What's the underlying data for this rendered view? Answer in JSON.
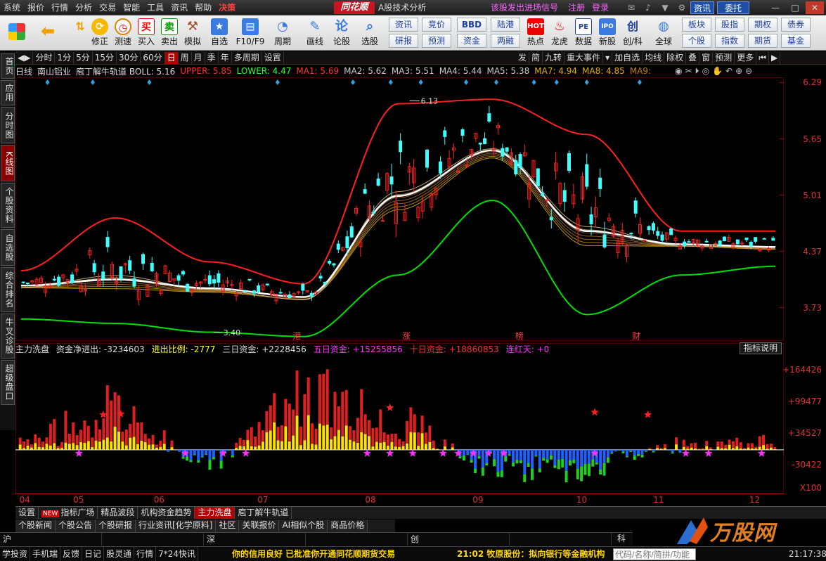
{
  "menubar": {
    "items": [
      "系统",
      "报价",
      "行情",
      "分析",
      "交易",
      "智能",
      "工具",
      "资讯",
      "帮助",
      "决策"
    ],
    "logo": "同花顺",
    "subtitle": "A股技术分析",
    "signal": "该股发出进场信号",
    "register": "注册",
    "login": "登录",
    "info_button": "资讯",
    "trust_button": "委托"
  },
  "toolbar": {
    "buttons": [
      "修正",
      "测速",
      "买入",
      "卖出",
      "模拟",
      "自选",
      "F10/F9",
      "周期",
      "画线",
      "论股",
      "选股"
    ],
    "quick_links": [
      "资讯",
      "竞价",
      "BBD",
      "陆港",
      "研报",
      "预测",
      "资金",
      "两融"
    ],
    "feature_buttons": [
      "热点",
      "龙虎",
      "数据",
      "新股",
      "创/科",
      "全球"
    ],
    "right_links": [
      "板块",
      "股指",
      "期权",
      "债券",
      "个股",
      "指数",
      "期货",
      "基金"
    ]
  },
  "side_tabs": [
    "首页",
    "应用",
    "分时图",
    "K线图",
    "个股资料",
    "自选股",
    "综合排名",
    "牛叉诊股",
    "超级盘口"
  ],
  "period_bar": {
    "items": [
      "分时",
      "1分",
      "5分",
      "15分",
      "30分",
      "60分",
      "日",
      "周",
      "月",
      "季",
      "年",
      "多周期",
      "设置"
    ],
    "active": "日",
    "right_items": [
      "发",
      "简",
      "九转",
      "重大事件",
      "加自选",
      "均线",
      "除权",
      "叠",
      "窗",
      "预测",
      "更多"
    ]
  },
  "indicator_line": {
    "period": "日线",
    "stock": "南山铝业",
    "indicator": "庖丁解牛轨道 BOLL: 5.16",
    "upper": "UPPER: 5.85",
    "lower": "LOWER: 4.47",
    "ma1": "MA1: 5.69",
    "ma2": "MA2: 5.62",
    "ma3": "MA3: 5.51",
    "ma4": "MA4: 5.44",
    "ma5": "MA5: 5.38",
    "ma7": "MA7: 4.94",
    "ma8": "MA8: 4.85",
    "ma9": "MA9:"
  },
  "main_axis": [
    "6.29",
    "5.65",
    "5.01",
    "4.37",
    "3.73"
  ],
  "annotations": {
    "high": "6.13",
    "low": "3.40",
    "markers": [
      "港",
      "涨",
      "榜",
      "财"
    ]
  },
  "sub_legend": {
    "name": "主力洗盘",
    "net_flow": "资金净进出: -3234603",
    "ratio": "进出比例: -2777",
    "three_day": "三日资金: +2228456",
    "five_day": "五日资金: +15255856",
    "ten_day": "十日资金: +18860853",
    "streak": "连红天: +0",
    "explain_button": "指标说明"
  },
  "sub_axis": [
    "+164426",
    "+99477",
    "+34527",
    "-30422",
    "X100"
  ],
  "months": [
    "04",
    "05",
    "06",
    "07",
    "08",
    "09",
    "10",
    "11",
    "12"
  ],
  "indicator_tabs": [
    "设置",
    "指标广场",
    "精品波段",
    "机构资金趋势",
    "主力洗盘",
    "庖丁解牛轨道"
  ],
  "new_badge": "NEW",
  "news_tabs": [
    "个股新闻",
    "个股公告",
    "个股研报",
    "行业资讯[化学原料]",
    "社区",
    "关联报价",
    "AI相似个股",
    "商品价格"
  ],
  "index_bar": [
    "沪",
    "深",
    "创",
    "科"
  ],
  "status_links": [
    "学投资",
    "手机端",
    "反馈",
    "日记",
    "股灵通",
    "行情",
    "7*24快讯"
  ],
  "ticker": {
    "left": "你的信用良好 已批准你开通同花顺期货交易",
    "right": "21:02 牧原股份：拟向银行等金融机构"
  },
  "search_placeholder": "代码/名称/简拼/功能",
  "clock": "21:17:38",
  "watermark": "万股网",
  "colors": {
    "upper": "#ff2020",
    "lower": "#00e000",
    "mid": "#ffffff",
    "up_candle": "#ff2020",
    "down_candle": "#40ffff",
    "ma_yellow": "#e0b000",
    "accent": "#b00000"
  },
  "chart_data": [
    {
      "type": "line",
      "title": "南山铝业 日线",
      "x": [
        "04",
        "05",
        "06",
        "07",
        "08",
        "09",
        "10",
        "11",
        "12"
      ],
      "series": [
        {
          "name": "UPPER",
          "values": [
            4.15,
            4.75,
            4.25,
            4.0,
            6.05,
            6.1,
            5.7,
            4.6,
            4.6
          ]
        },
        {
          "name": "MID",
          "values": [
            3.98,
            4.05,
            3.95,
            3.85,
            5.0,
            5.52,
            4.6,
            4.45,
            4.42
          ]
        },
        {
          "name": "LOWER",
          "values": [
            3.6,
            3.55,
            3.45,
            3.4,
            4.1,
            4.95,
            3.65,
            4.1,
            4.2
          ]
        }
      ],
      "ylim": [
        3.35,
        6.35
      ],
      "high_label": 6.13,
      "low_label": 3.4
    },
    {
      "type": "bar",
      "title": "主力洗盘",
      "x": [
        "04",
        "05",
        "06",
        "07",
        "08",
        "09",
        "10",
        "11",
        "12"
      ],
      "values": [
        200,
        900,
        -300,
        1300,
        700,
        -400,
        -500,
        150,
        200
      ],
      "ylim": [
        -900,
        2200
      ],
      "unit": "X100"
    }
  ]
}
